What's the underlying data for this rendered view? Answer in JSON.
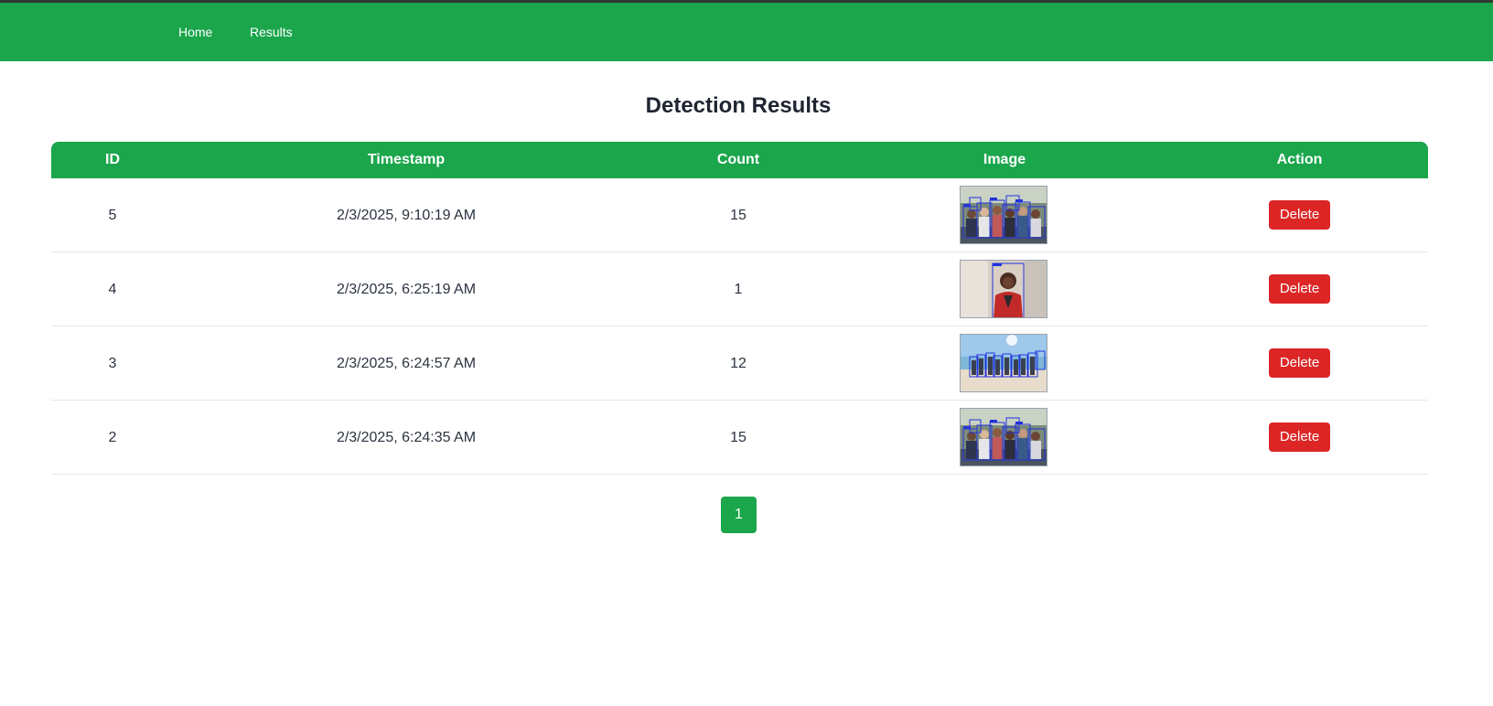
{
  "nav": {
    "home_label": "Home",
    "results_label": "Results"
  },
  "page": {
    "title": "Detection Results"
  },
  "table": {
    "headers": {
      "id": "ID",
      "timestamp": "Timestamp",
      "count": "Count",
      "image": "Image",
      "action": "Action"
    },
    "rows": [
      {
        "id": "5",
        "timestamp": "2/3/2025, 9:10:19 AM",
        "count": "15",
        "image_desc": "group-photo-detections-thumbnail",
        "action_label": "Delete"
      },
      {
        "id": "4",
        "timestamp": "2/3/2025, 6:25:19 AM",
        "count": "1",
        "image_desc": "single-person-detection-thumbnail",
        "action_label": "Delete"
      },
      {
        "id": "3",
        "timestamp": "2/3/2025, 6:24:57 AM",
        "count": "12",
        "image_desc": "beach-group-detections-thumbnail",
        "action_label": "Delete"
      },
      {
        "id": "2",
        "timestamp": "2/3/2025, 6:24:35 AM",
        "count": "15",
        "image_desc": "group-photo-detections-thumbnail",
        "action_label": "Delete"
      }
    ]
  },
  "pagination": {
    "current_page": "1"
  },
  "colors": {
    "brand_green": "#1ba64c",
    "danger_red": "#dc2626",
    "detection_box_blue": "#2233dd"
  }
}
